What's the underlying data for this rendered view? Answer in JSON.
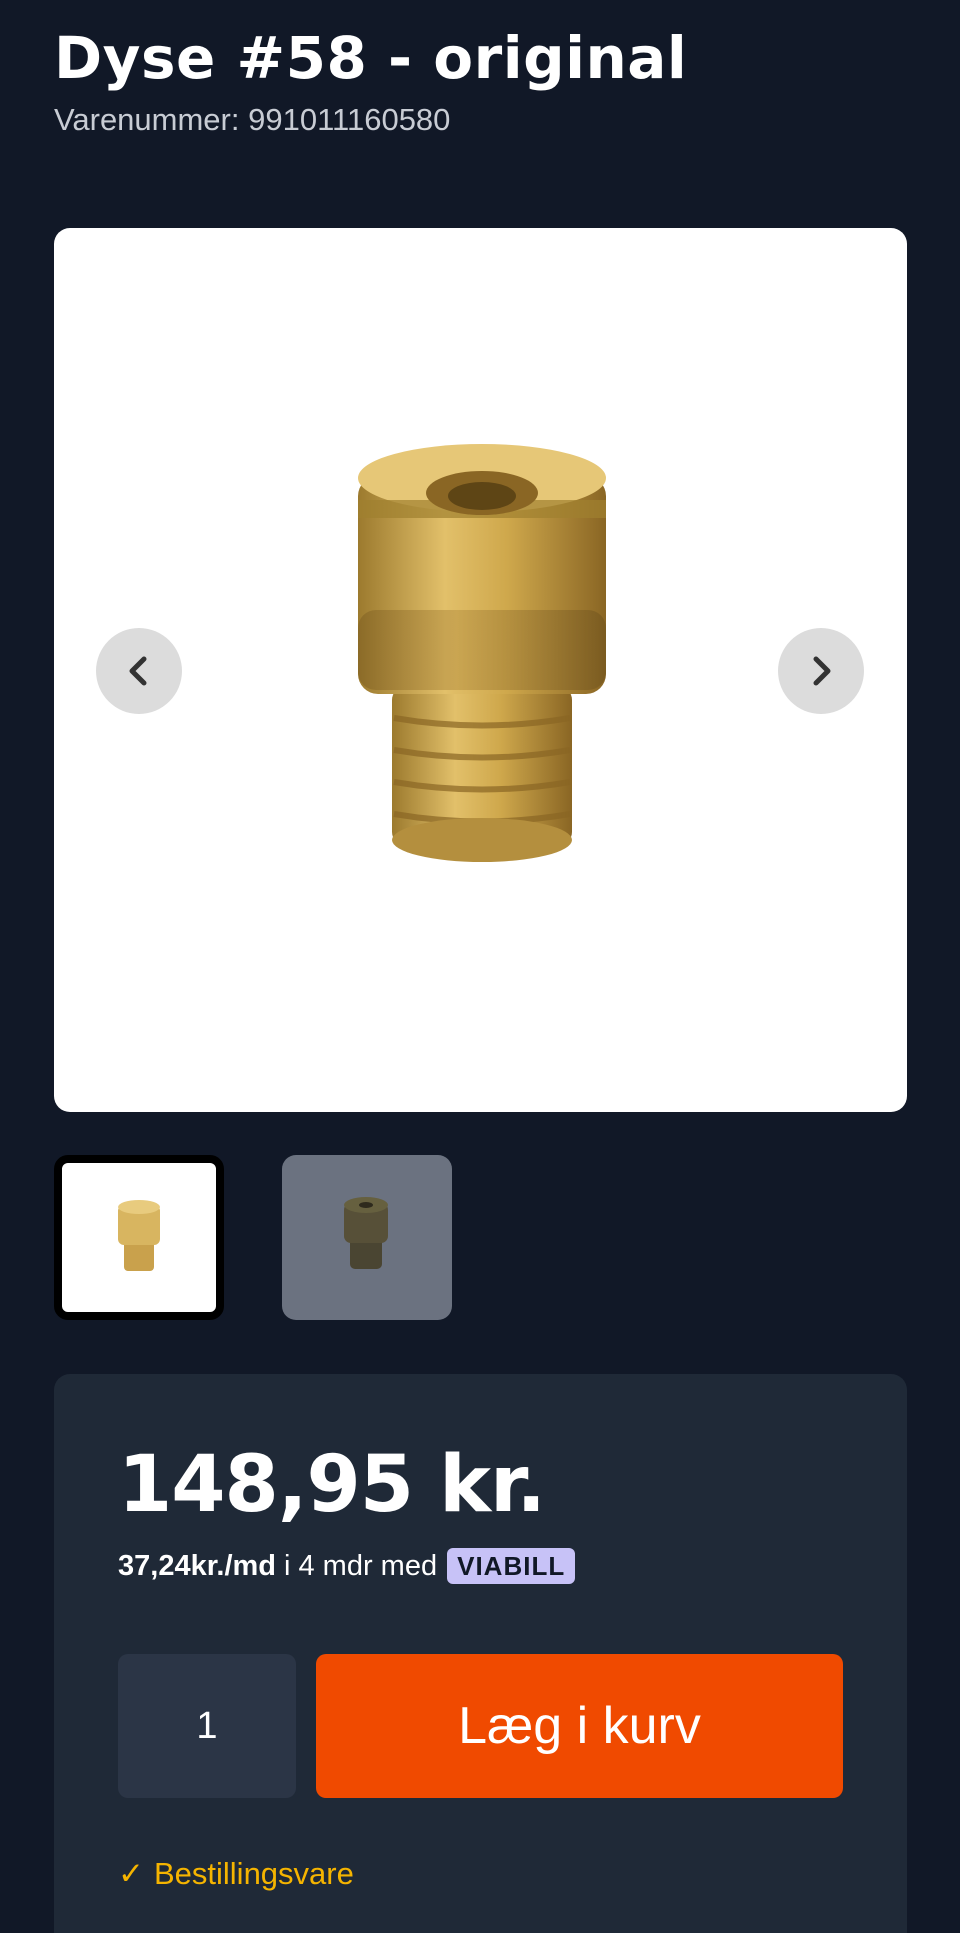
{
  "product": {
    "title": "Dyse #58 - original",
    "sku_label": "Varenummer:",
    "sku_value": "991011160580",
    "image_name": "brass-jet-nozzle"
  },
  "gallery": {
    "prev_icon": "chevron-left-icon",
    "next_icon": "chevron-right-icon",
    "thumbnails": [
      {
        "name": "thumbnail-1",
        "selected": true
      },
      {
        "name": "thumbnail-2",
        "selected": false
      }
    ]
  },
  "purchase": {
    "price": "148,95 kr.",
    "installment_amount": "37,24kr./md",
    "installment_text": "i 4 mdr med",
    "installment_provider": "VIABILL",
    "quantity": "1",
    "add_to_cart_label": "Læg i kurv",
    "stock_check": "✓",
    "stock_status": "Bestillingsvare"
  },
  "colors": {
    "background": "#111827",
    "panel": "#1f2937",
    "accent": "#f04a00",
    "stock": "#f5b400",
    "viabill_badge": "#c7c2f7"
  }
}
